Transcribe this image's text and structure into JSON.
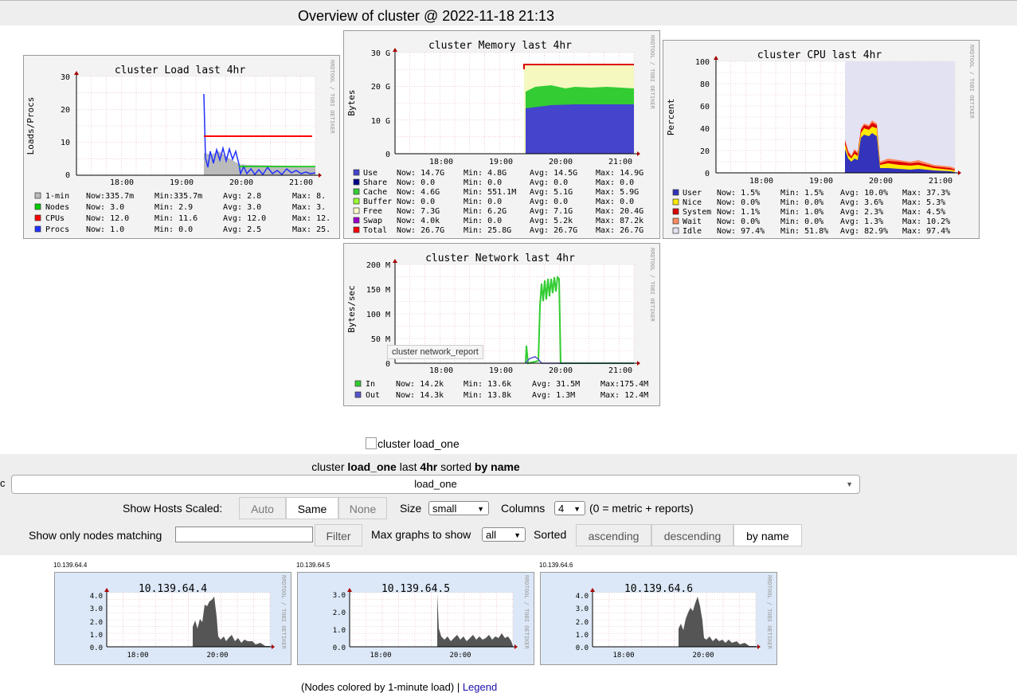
{
  "page": {
    "title": "Overview of cluster @ 2022-11-18 21:13"
  },
  "rrd_watermark": "RRDTOOL / TOBI OETIKER",
  "tooltip": "cluster network_report",
  "broken_image_alt": "cluster load_one",
  "time_ticks": [
    "18:00",
    "19:00",
    "20:00",
    "21:00"
  ],
  "colors": {
    "plot_bg": "#ffffff",
    "panel_bg": "#f3f3f3",
    "host_bg": "#dce8f7",
    "host_area": "#555555"
  },
  "graphs": {
    "load": {
      "title": "cluster Load last 4hr",
      "ylabel": "Loads/Procs",
      "yticks": [
        "30",
        "20",
        "10",
        "0"
      ],
      "legend": [
        {
          "color": "#bbbbbb",
          "name": "1-min",
          "now": "Now:335.7m",
          "min": "Min:335.7m",
          "avg": "Avg:   2.8",
          "max": "Max:   8."
        },
        {
          "color": "#00cc00",
          "name": "Nodes",
          "now": "Now:   3.0",
          "min": "Min:   2.9",
          "avg": "Avg:   3.0",
          "max": "Max:   3."
        },
        {
          "color": "#ff0000",
          "name": "CPUs",
          "now": "Now:  12.0",
          "min": "Min:  11.6",
          "avg": "Avg:  12.0",
          "max": "Max:  12."
        },
        {
          "color": "#2030ff",
          "name": "Procs",
          "now": "Now:   1.0",
          "min": "Min:   0.0",
          "avg": "Avg:   2.5",
          "max": "Max:  25."
        }
      ]
    },
    "memory": {
      "title": "cluster Memory last 4hr",
      "ylabel": "Bytes",
      "yticks": [
        "30 G",
        "20 G",
        "10 G",
        "0"
      ],
      "legend": [
        {
          "color": "#4444cc",
          "name": "Use",
          "now": "Now:  14.7G",
          "min": "Min:   4.8G",
          "avg": "Avg:  14.5G",
          "max": "Max:  14.9G"
        },
        {
          "color": "#000088",
          "name": "Share",
          "now": "Now:    0.0",
          "min": "Min:    0.0",
          "avg": "Avg:    0.0",
          "max": "Max:    0.0"
        },
        {
          "color": "#33cc33",
          "name": "Cache",
          "now": "Now:   4.6G",
          "min": "Min: 551.1M",
          "avg": "Avg:   5.1G",
          "max": "Max:   5.9G"
        },
        {
          "color": "#99ff33",
          "name": "Buffer",
          "now": "Now:    0.0",
          "min": "Min:    0.0",
          "avg": "Avg:    0.0",
          "max": "Max:    0.0"
        },
        {
          "color": "#ffffcc",
          "name": "Free",
          "now": "Now:   7.3G",
          "min": "Min:   6.2G",
          "avg": "Avg:   7.1G",
          "max": "Max:  20.4G"
        },
        {
          "color": "#9900cc",
          "name": "Swap",
          "now": "Now:   4.0k",
          "min": "Min:    0.0",
          "avg": "Avg:   5.2k",
          "max": "Max:  87.2k"
        },
        {
          "color": "#ff0000",
          "name": "Total",
          "now": "Now:  26.7G",
          "min": "Min:  25.8G",
          "avg": "Avg:  26.7G",
          "max": "Max:  26.7G"
        }
      ]
    },
    "cpu": {
      "title": "cluster CPU last 4hr",
      "ylabel": "Percent",
      "yticks": [
        "100",
        "80",
        "60",
        "40",
        "20",
        "0"
      ],
      "legend": [
        {
          "color": "#3333bb",
          "name": "User",
          "now": "Now:  1.5%",
          "min": "Min:  1.5%",
          "avg": "Avg: 10.0%",
          "max": "Max: 37.3%"
        },
        {
          "color": "#ffea00",
          "name": "Nice",
          "now": "Now:  0.0%",
          "min": "Min:  0.0%",
          "avg": "Avg:  3.6%",
          "max": "Max:  5.3%"
        },
        {
          "color": "#dd0000",
          "name": "System",
          "now": "Now:  1.1%",
          "min": "Min:  1.0%",
          "avg": "Avg:  2.3%",
          "max": "Max:  4.5%"
        },
        {
          "color": "#ff8a60",
          "name": "Wait",
          "now": "Now:  0.0%",
          "min": "Min:  0.0%",
          "avg": "Avg:  1.3%",
          "max": "Max: 10.2%"
        },
        {
          "color": "#e2e2f2",
          "name": "Idle",
          "now": "Now: 97.4%",
          "min": "Min: 51.8%",
          "avg": "Avg: 82.9%",
          "max": "Max: 97.4%"
        }
      ]
    },
    "network": {
      "title": "cluster Network last 4hr",
      "ylabel": "Bytes/sec",
      "yticks": [
        "200 M",
        "150 M",
        "100 M",
        "50 M",
        "0"
      ],
      "legend": [
        {
          "color": "#33cc33",
          "name": "In",
          "now": "Now: 14.2k",
          "min": "Min: 13.6k",
          "avg": "Avg: 31.5M",
          "max": "Max:175.4M"
        },
        {
          "color": "#5555cc",
          "name": "Out",
          "now": "Now: 14.3k",
          "min": "Min: 13.8k",
          "avg": "Avg:  1.3M",
          "max": "Max: 12.4M"
        }
      ]
    }
  },
  "controls": {
    "metric_heading": {
      "prefix": "cluster ",
      "metric": "load_one",
      "mid": " last ",
      "range": "4hr",
      "mid2": " sorted ",
      "sort": "by name"
    },
    "metric_value": "load_one",
    "edge_char": "c",
    "scaled_label": "Show Hosts Scaled:",
    "scaled_options": [
      "Auto",
      "Same",
      "None"
    ],
    "size_label": "Size",
    "size_value": "small",
    "columns_label": "Columns",
    "columns_value": "4",
    "columns_note": "(0 = metric + reports)",
    "match_label": "Show only nodes matching",
    "filter_button": "Filter",
    "max_label": "Max graphs to show",
    "max_value": "all",
    "sorted_label": "Sorted",
    "sort_options": [
      "ascending",
      "descending",
      "by name"
    ]
  },
  "hosts": [
    {
      "label": "10.139.64.4",
      "title": "10.139.64.4",
      "yticks": [
        "4.0",
        "3.0",
        "2.0",
        "1.0",
        "0.0"
      ]
    },
    {
      "label": "10.139.64.5",
      "title": "10.139.64.5",
      "yticks": [
        "3.0",
        "2.0",
        "1.0",
        "0.0"
      ]
    },
    {
      "label": "10.139.64.6",
      "title": "10.139.64.6",
      "yticks": [
        "4.0",
        "3.0",
        "2.0",
        "1.0",
        "0.0"
      ]
    }
  ],
  "host_time_ticks": [
    "18:00",
    "20:00"
  ],
  "footer": {
    "text": "(Nodes colored by 1-minute load) | ",
    "link": "Legend"
  }
}
